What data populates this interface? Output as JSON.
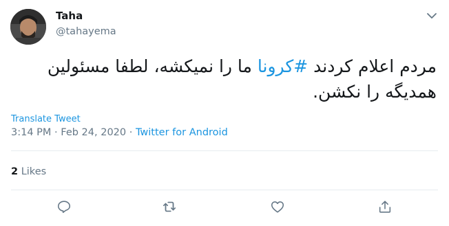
{
  "author": {
    "name": "Taha",
    "handle": "@tahayema"
  },
  "tweet": {
    "text_before": "مردم اعلام کردند ",
    "hashtag": "#کرونا",
    "text_after": " ما را نمیکشه، لطفا مسئولین همدیگه را نکشن."
  },
  "translate_label": "Translate Tweet",
  "meta": {
    "time": "3:14 PM",
    "sep1": " · ",
    "date": "Feb 24, 2020",
    "sep2": " · ",
    "source": "Twitter for Android"
  },
  "likes": {
    "count": "2",
    "label": "Likes"
  },
  "icons": {
    "menu": "chevron-down-icon",
    "reply": "reply-icon",
    "retweet": "retweet-icon",
    "like": "heart-icon",
    "share": "share-icon"
  },
  "colors": {
    "link": "#1b95e0",
    "muted": "#657786",
    "text": "#14171a"
  }
}
